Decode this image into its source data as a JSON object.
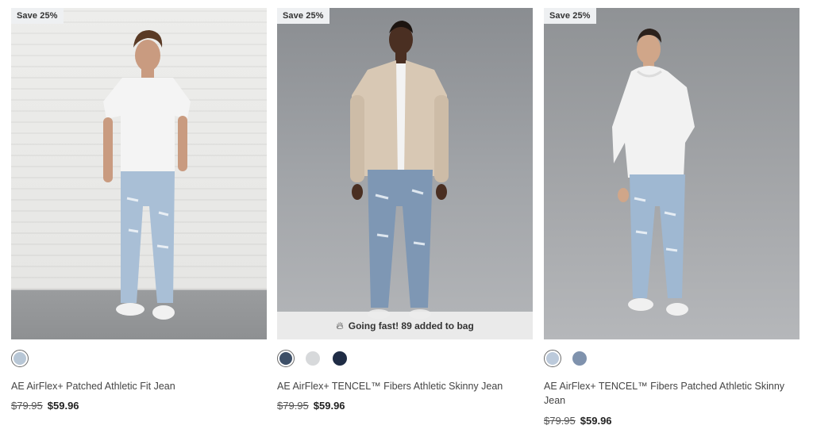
{
  "products": [
    {
      "badge": "Save 25%",
      "title": "AE AirFlex+ Patched Athletic Fit Jean",
      "old_price": "$79.95",
      "new_price": "$59.96",
      "swatches": [
        "#b8c7d6"
      ],
      "selected_swatch": 0
    },
    {
      "badge": "Save 25%",
      "title": "AE AirFlex+ TENCEL™ Fibers Athletic Skinny Jean",
      "old_price": "$79.95",
      "new_price": "$59.96",
      "swatches": [
        "#3e5068",
        "#d7d9db",
        "#1f2c45"
      ],
      "selected_swatch": 0,
      "going_fast": "Going fast! 89 added to bag",
      "going_fast_icon": "flame-icon"
    },
    {
      "badge": "Save 25%",
      "title": "AE AirFlex+ TENCEL™ Fibers Patched Athletic Skinny Jean",
      "old_price": "$79.95",
      "new_price": "$59.96",
      "swatches": [
        "#bccadb",
        "#7f92ad"
      ],
      "selected_swatch": 0
    }
  ]
}
